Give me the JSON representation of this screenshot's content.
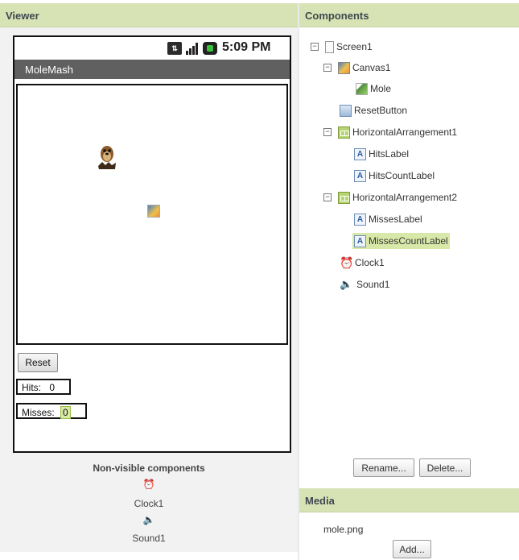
{
  "viewer": {
    "header": "Viewer",
    "status_bar": {
      "time": "5:09 PM",
      "icons": [
        "dual-sim-icon",
        "signal-icon",
        "battery-icon"
      ]
    },
    "app_title": "MoleMash",
    "reset_label": "Reset",
    "hits_label": "Hits:",
    "hits_count": "0",
    "misses_label": "Misses:",
    "misses_count": "0",
    "nonvisible_title": "Non-visible components",
    "nonvisible": [
      {
        "label": "Clock1",
        "icon": "clock-icon"
      },
      {
        "label": "Sound1",
        "icon": "speaker-icon"
      }
    ]
  },
  "components": {
    "header": "Components",
    "tree": [
      {
        "label": "Screen1",
        "icon": "screen-icon",
        "expanded": true
      },
      {
        "label": "Canvas1",
        "icon": "canvas-icon",
        "expanded": true
      },
      {
        "label": "Mole",
        "icon": "image-sprite-icon"
      },
      {
        "label": "ResetButton",
        "icon": "button-icon"
      },
      {
        "label": "HorizontalArrangement1",
        "icon": "horizontal-arrangement-icon",
        "expanded": true
      },
      {
        "label": "HitsLabel",
        "icon": "label-icon"
      },
      {
        "label": "HitsCountLabel",
        "icon": "label-icon"
      },
      {
        "label": "HorizontalArrangement2",
        "icon": "horizontal-arrangement-icon",
        "expanded": true
      },
      {
        "label": "MissesLabel",
        "icon": "label-icon"
      },
      {
        "label": "MissesCountLabel",
        "icon": "label-icon",
        "selected": true
      },
      {
        "label": "Clock1",
        "icon": "clock-icon"
      },
      {
        "label": "Sound1",
        "icon": "speaker-icon"
      }
    ],
    "rename_label": "Rename...",
    "delete_label": "Delete..."
  },
  "media": {
    "header": "Media",
    "files": [
      "mole.png"
    ],
    "add_label": "Add..."
  },
  "colors": {
    "header_bg": "#d7e3b4",
    "selection": "#d8e8a8",
    "title_bar": "#606060"
  }
}
